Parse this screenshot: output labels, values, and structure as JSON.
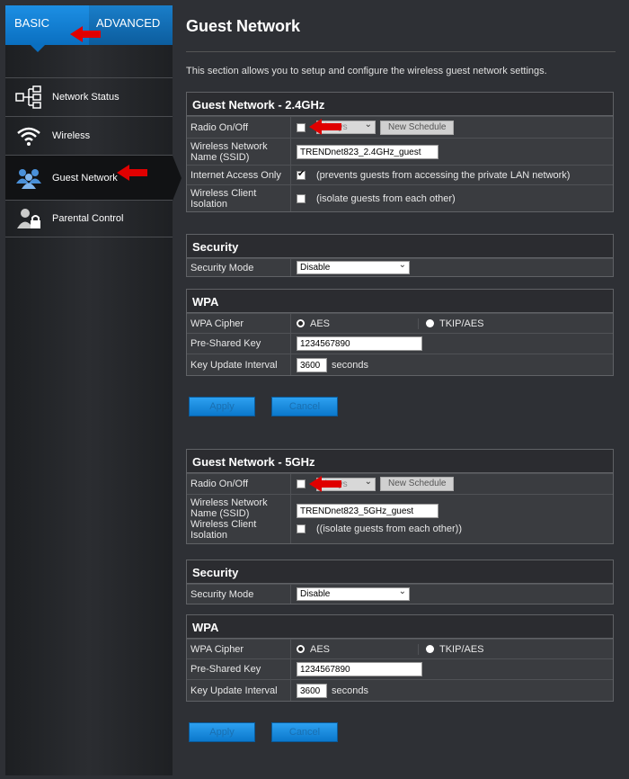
{
  "tabs": {
    "basic": "BASIC",
    "advanced": "ADVANCED"
  },
  "sidebar": {
    "items": [
      {
        "label": "Network Status"
      },
      {
        "label": "Wireless"
      },
      {
        "label": "Guest Network"
      },
      {
        "label": "Parental Control"
      }
    ]
  },
  "page": {
    "title": "Guest Network",
    "description": "This section allows you to setup and configure the wireless guest network settings."
  },
  "g24": {
    "header": "Guest Network - 2.4GHz",
    "radio_label": "Radio On/Off",
    "schedule_value": "Always",
    "schedule_button": "New Schedule",
    "ssid_label": "Wireless Network Name (SSID)",
    "ssid_value": "TRENDnet823_2.4GHz_guest",
    "internet_label": "Internet Access Only",
    "internet_note": "(prevents guests from accessing the private LAN network)",
    "isolation_label": "Wireless Client Isolation",
    "isolation_note": "(isolate guests from each other)"
  },
  "sec24": {
    "header": "Security",
    "mode_label": "Security Mode",
    "mode_value": "Disable"
  },
  "wpa24": {
    "header": "WPA",
    "cipher_label": "WPA Cipher",
    "aes": "AES",
    "tkip": "TKIP/AES",
    "psk_label": "Pre-Shared Key",
    "psk_value": "1234567890",
    "interval_label": "Key Update Interval",
    "interval_value": "3600",
    "interval_unit": "seconds"
  },
  "g5": {
    "header": "Guest Network - 5GHz",
    "radio_label": "Radio On/Off",
    "schedule_value": "Always",
    "schedule_button": "New Schedule",
    "ssid_label": "Wireless Network Name (SSID)",
    "ssid_value": "TRENDnet823_5GHz_guest",
    "isolation_label": "Wireless Client Isolation",
    "isolation_note": "((isolate guests from each other))"
  },
  "sec5": {
    "header": "Security",
    "mode_label": "Security Mode",
    "mode_value": "Disable"
  },
  "wpa5": {
    "header": "WPA",
    "cipher_label": "WPA Cipher",
    "aes": "AES",
    "tkip": "TKIP/AES",
    "psk_label": "Pre-Shared Key",
    "psk_value": "1234567890",
    "interval_label": "Key Update Interval",
    "interval_value": "3600",
    "interval_unit": "seconds"
  },
  "buttons": {
    "apply": "Apply",
    "cancel": "Cancel"
  },
  "colors": {
    "accent": "#1d8fe4",
    "arrow": "#e00000",
    "background": "#2e3035"
  }
}
